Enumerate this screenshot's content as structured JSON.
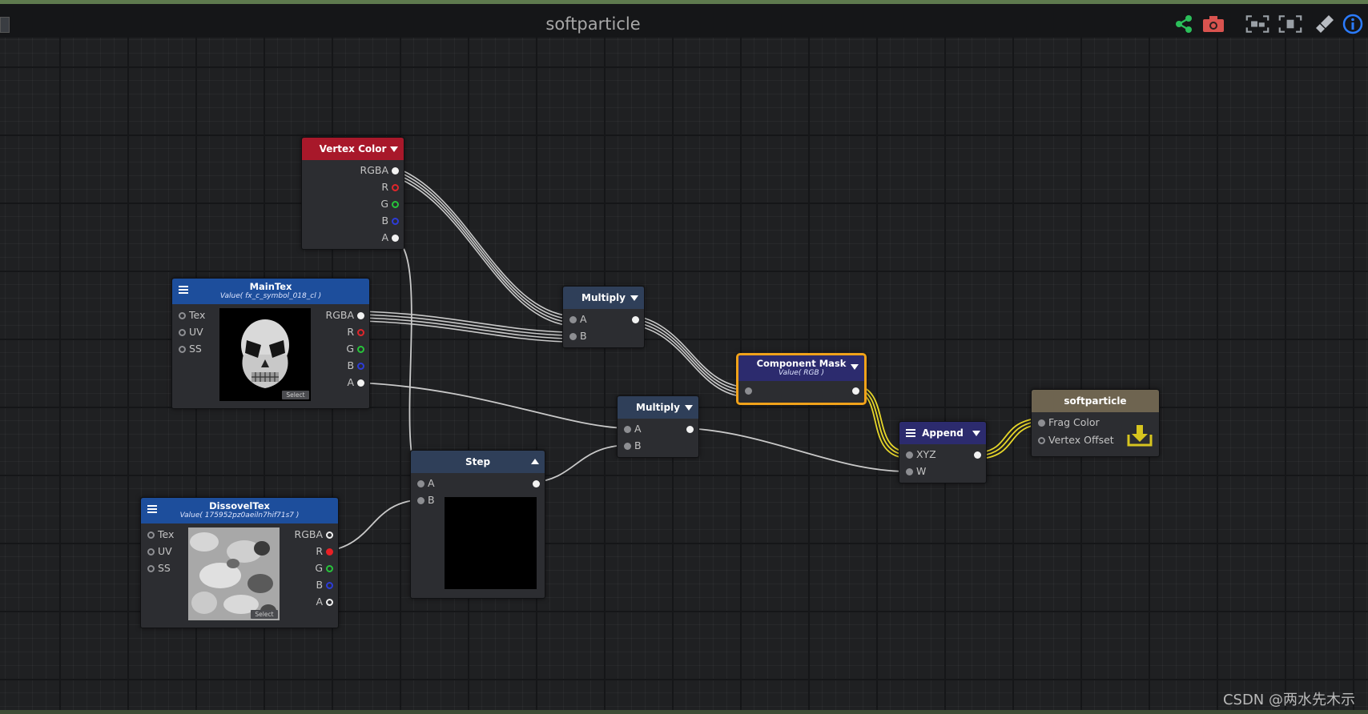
{
  "window": {
    "title": "softparticle"
  },
  "toolbar": {
    "icons": [
      "share-icon",
      "camera-icon",
      "fit-view-icon",
      "focus-view-icon",
      "clean-up-icon",
      "info-icon"
    ],
    "colors": {
      "share": "#2bbf5a",
      "camera": "#d9534f",
      "fit": "#9aa0a6",
      "clean": "#b8bcc2",
      "info": "#2b7cff"
    }
  },
  "nodes": {
    "vertex_color": {
      "title": "Vertex Color",
      "outputs": [
        "RGBA",
        "R",
        "G",
        "B",
        "A"
      ],
      "color": "#a8182a"
    },
    "maintex": {
      "title": "MainTex",
      "subtitle": "Value( fx_c_symbol_018_cl )",
      "inputs": [
        "Tex",
        "UV",
        "SS"
      ],
      "outputs": [
        "RGBA",
        "R",
        "G",
        "B",
        "A"
      ],
      "select_label": "Select",
      "color": "#1d4e9c"
    },
    "dissolvetex": {
      "title": "DissovelTex",
      "subtitle": "Value( 175952pz0aeiln7hif71s7 )",
      "inputs": [
        "Tex",
        "UV",
        "SS"
      ],
      "outputs": [
        "RGBA",
        "R",
        "G",
        "B",
        "A"
      ],
      "select_label": "Select",
      "color": "#1d4e9c"
    },
    "multiply1": {
      "title": "Multiply",
      "inputs": [
        "A",
        "B"
      ]
    },
    "multiply2": {
      "title": "Multiply",
      "inputs": [
        "A",
        "B"
      ]
    },
    "step": {
      "title": "Step",
      "inputs": [
        "A",
        "B"
      ]
    },
    "component_mask": {
      "title": "Component Mask",
      "subtitle": "Value( RGB )",
      "border": "#f0a21a"
    },
    "append": {
      "title": "Append",
      "inputs": [
        "XYZ",
        "W"
      ]
    },
    "output": {
      "title": "softparticle",
      "inputs": [
        "Frag Color",
        "Vertex Offset"
      ]
    }
  },
  "watermark": "CSDN @两水先木示"
}
